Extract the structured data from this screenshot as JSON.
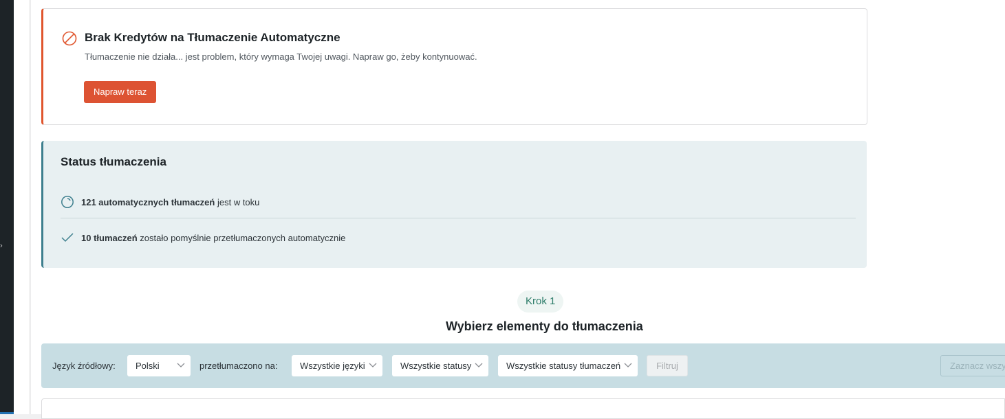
{
  "error_card": {
    "title": "Brak Kredytów na Tłumaczenie Automatyczne",
    "description": "Tłumaczenie nie działa... jest problem, który wymaga Twojej uwagi. Napraw go, żeby kontynuować.",
    "fix_button_label": "Napraw teraz",
    "accent_color": "#e0552d",
    "icon": "prohibited-icon"
  },
  "status": {
    "title": "Status tłumaczenia",
    "in_progress": {
      "bold": "121 automatycznych tłumaczeń",
      "rest": " jest w toku",
      "icon": "clock-icon"
    },
    "completed": {
      "bold": "10 tłumaczeń",
      "rest": " zostało pomyślnie przetłumaczonych automatycznie",
      "icon": "checkmark-icon"
    }
  },
  "step": {
    "badge": "Krok 1",
    "title": "Wybierz elementy do tłumaczenia"
  },
  "filters": {
    "source_label": "Język źródłowy:",
    "source_value": "Polski",
    "translated_label": "przetłumaczono na:",
    "languages_value": "Wszystkie języki",
    "status_value": "Wszystkie statusy",
    "translation_status_value": "Wszystkie statusy tłumaczeń",
    "filter_button": "Filtruj",
    "select_all_button": "Zaznacz wszystkie"
  }
}
